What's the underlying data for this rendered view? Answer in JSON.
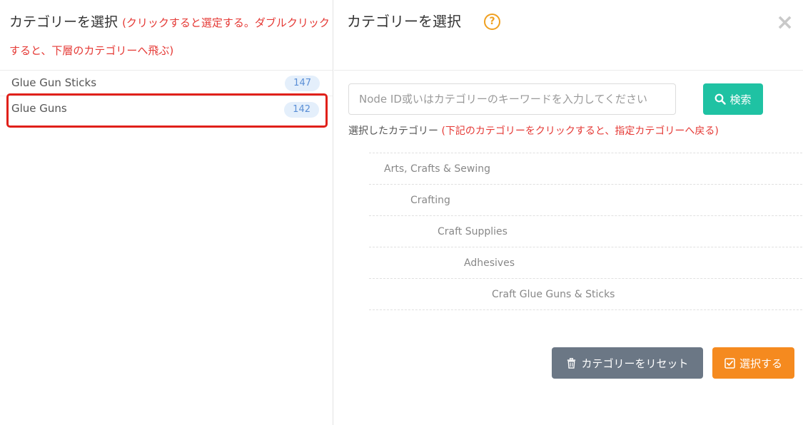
{
  "left": {
    "title": "カテゴリーを選択",
    "hint": "(クリックすると選定する。ダブルクリックすると、下層のカテゴリーへ飛ぶ)",
    "categories": [
      {
        "label": "Glue Gun Sticks",
        "count": "147"
      },
      {
        "label": "Glue Guns",
        "count": "142"
      }
    ]
  },
  "right": {
    "title": "カテゴリーを選択",
    "help": "?",
    "close": "×",
    "search": {
      "placeholder": "Node ID或いはカテゴリーのキーワードを入力してください",
      "button": "検索"
    },
    "selected": {
      "label": "選択したカテゴリー",
      "hint": "(下記のカテゴリーをクリックすると、指定カテゴリーへ戻る)"
    },
    "breadcrumbs": [
      "Arts, Crafts & Sewing",
      "Crafting",
      "Craft Supplies",
      "Adhesives",
      "Craft Glue Guns & Sticks"
    ],
    "buttons": {
      "reset": "カテゴリーをリセット",
      "select": "選択する"
    }
  },
  "colors": {
    "accent_teal": "#1fc2a3",
    "accent_orange": "#f58a1f",
    "reset_gray": "#6b7785",
    "hint_red": "#e53935",
    "highlight_red": "#e0201a"
  },
  "icons": {
    "help": "question-circle-icon",
    "close": "close-icon",
    "search": "magnifier-icon",
    "reset": "trash-icon",
    "select": "checkbox-icon"
  }
}
